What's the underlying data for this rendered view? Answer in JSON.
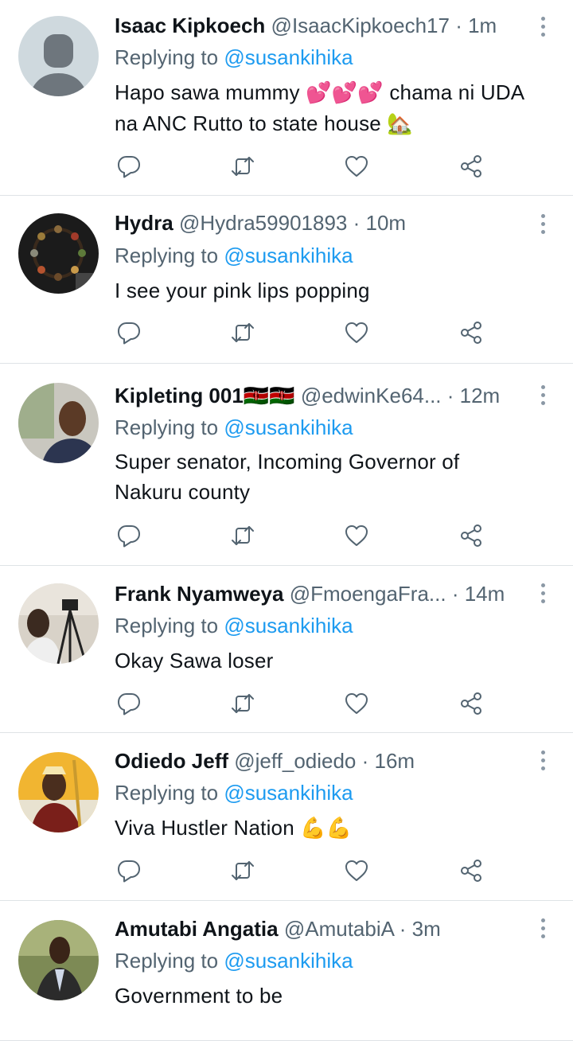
{
  "tweets": [
    {
      "name": "Isaac Kipkoech",
      "handle": "@IsaacKipkoech17",
      "time": "1m",
      "replying_prefix": "Replying to ",
      "replying_to": "@susankihika",
      "text_parts": [
        "Hapo sawa mummy ",
        "💕💕💕",
        " chama ni UDA",
        "na ANC Rutto to state house ",
        "🏡"
      ],
      "avatar": "default-avatar"
    },
    {
      "name": "Hydra",
      "handle": "@Hydra59901893",
      "time": "10m",
      "replying_prefix": "Replying to ",
      "replying_to": "@susankihika",
      "text": "I see your pink lips popping",
      "avatar": "bracelet-photo"
    },
    {
      "name": "Kipleting 001",
      "name_flags": "🇰🇪🇰🇪",
      "handle": "@edwinKe64...",
      "time": "12m",
      "replying_prefix": "Replying to ",
      "replying_to": "@susankihika",
      "text": "Super senator, Incoming Governor of Nakuru county",
      "avatar": "man-photo"
    },
    {
      "name": "Frank Nyamweya",
      "handle": "@FmoengaFra...",
      "time": "14m",
      "replying_prefix": "Replying to ",
      "replying_to": "@susankihika",
      "text": "Okay Sawa loser",
      "avatar": "camera-photo"
    },
    {
      "name": "Odiedo Jeff",
      "handle": "@jeff_odiedo",
      "time": "16m",
      "replying_prefix": "Replying to ",
      "replying_to": "@susankihika",
      "text": "Viva Hustler Nation ",
      "text_emoji": "💪💪",
      "avatar": "traditional-attire-photo"
    },
    {
      "name": "Amutabi Angatia",
      "handle": "@AmutabiA",
      "time": "3m",
      "replying_prefix": "Replying to ",
      "replying_to": "@susankihika",
      "text": "Government to be",
      "avatar": "suit-photo"
    }
  ],
  "separator": " · ",
  "colors": {
    "link": "#1d9bf0",
    "secondary_text": "#536471",
    "primary_text": "#0f1419",
    "divider": "#dfe3e6"
  },
  "icons": [
    "reply-icon",
    "retweet-icon",
    "like-icon",
    "share-icon",
    "more-options-icon"
  ]
}
